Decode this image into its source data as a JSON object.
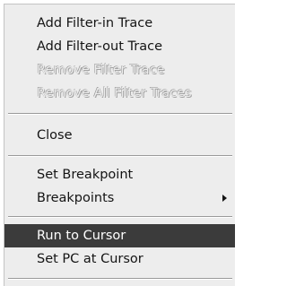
{
  "context_menu": {
    "items": [
      {
        "label": "Add Filter-in Trace",
        "enabled": true
      },
      {
        "label": "Add Filter-out Trace",
        "enabled": true
      },
      {
        "label": "Remove Filter Trace",
        "enabled": false
      },
      {
        "label": "Remove All Filter Traces",
        "enabled": false
      },
      {
        "label": "Close",
        "enabled": true
      },
      {
        "label": "Set Breakpoint",
        "enabled": true
      },
      {
        "label": "Breakpoints",
        "enabled": true,
        "has_submenu": true
      },
      {
        "label": "Run to Cursor",
        "enabled": true,
        "highlighted": true
      },
      {
        "label": "Set PC at Cursor",
        "enabled": true
      }
    ],
    "submenu_icon": "chevron-right-icon",
    "colors": {
      "background": "#ededed",
      "highlight": "#3b3b3b",
      "highlight_text": "#ffffff",
      "text": "#141414"
    }
  }
}
